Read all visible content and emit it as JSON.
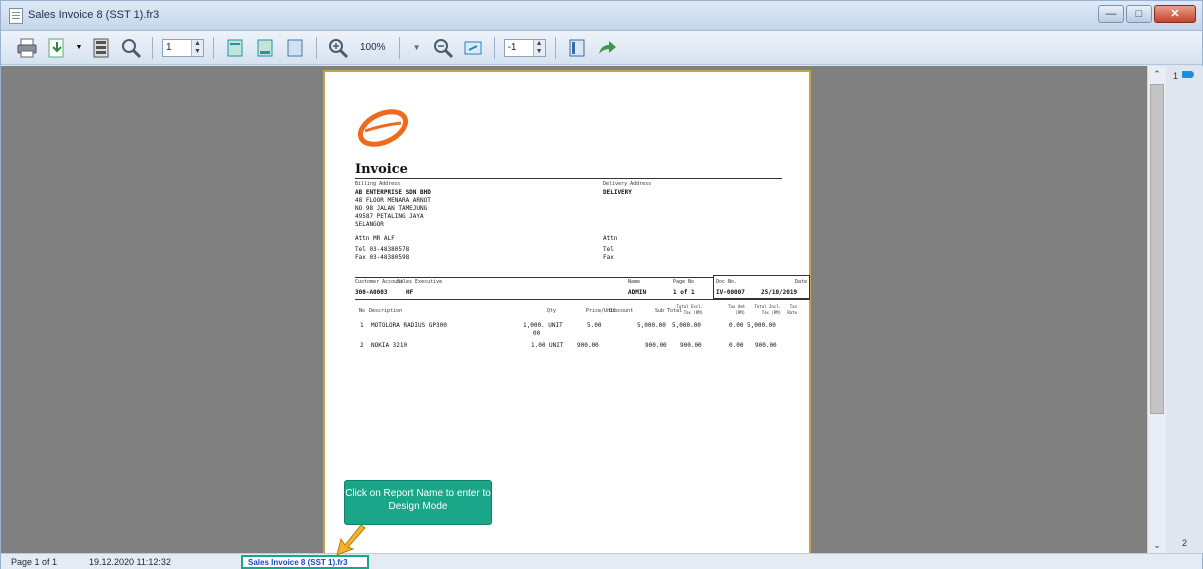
{
  "window": {
    "title": "Sales Invoice 8 (SST 1).fr3"
  },
  "toolbar": {
    "page_value": "1",
    "zoom": "100%",
    "page_width_value": "-1"
  },
  "scroll": {
    "top_page": "1",
    "bottom_page": "2"
  },
  "invoice": {
    "title": "Invoice",
    "billing_label": "Billing Address",
    "billing_name": "AB ENTERPRISE SDN BHD",
    "billing_lines": [
      "48 FLOOR MENARA ARNOT",
      "NO 98 JALAN TAMEJUNG",
      "49587 PETALING JAYA",
      "SELANGOR"
    ],
    "delivery_label": "Delivery Address",
    "delivery_name": "DELIVERY",
    "attn_left": "Attn  MR ALF",
    "tel_left": "Tel  03-48380578",
    "fax_left": "Fax  03-48380598",
    "attn_right": "Attn",
    "tel_right": "Tel",
    "fax_right": "Fax",
    "customer_account_label": "Customer Account",
    "customer_account": "300-A0003",
    "sales_exec_label": "Sales Executive",
    "sales_exec": "HF",
    "name_label": "Name",
    "name": "ADMIN",
    "page_label": "Page No",
    "page": "1 of 1",
    "doc_label": "Doc No.",
    "doc_no": "IV-00007",
    "date_label": "Date",
    "date": "25/10/2019",
    "columns": [
      "No",
      "Description",
      "Qty",
      "Price/Unit",
      "Discount",
      "Sub Total",
      "Total Excl. Tax (RM)",
      "Tax Amt (RM)",
      "Total Incl. Tax (RM)",
      "Tax Rate"
    ],
    "rows": [
      {
        "no": "1",
        "desc": "MOTOLORA RADIUS GP300",
        "qty": "1,000. UNIT",
        "qty2": "00",
        "price": "5.00",
        "subtotal": "5,000.00",
        "excl": "5,000.00",
        "tax": "0.00",
        "incl": "5,000.00"
      },
      {
        "no": "2",
        "desc": "NOKIA 3210",
        "qty": "1.00 UNIT",
        "qty2": "",
        "price": "900.00",
        "subtotal": "900.00",
        "excl": "900.00",
        "tax": "0.00",
        "incl": "900.00"
      }
    ]
  },
  "callout": {
    "text": "Click on Report Name to enter to Design Mode"
  },
  "status": {
    "page": "Page 1 of 1",
    "datetime": "19.12.2020 11:12:32",
    "report_name": "Sales Invoice 8 (SST 1).fr3"
  },
  "colors": {
    "callout": "#1aa689",
    "page_border": "#c8a24a",
    "report_link": "#1a44c9"
  }
}
